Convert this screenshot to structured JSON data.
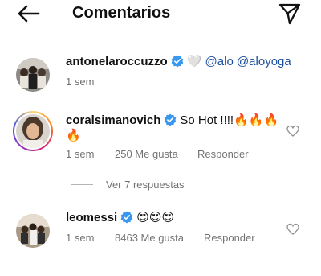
{
  "header": {
    "title": "Comentarios",
    "back_icon": "arrow-left-icon",
    "send_icon": "paper-plane-icon"
  },
  "comments": [
    {
      "username": "antonelaroccuzzo",
      "text": "@alo @aloyoga",
      "text_prefix": "🤍",
      "time": "1 sem"
    },
    {
      "username": "coralsimanovich",
      "text": "So Hot !!!!🔥🔥🔥",
      "text_cont": "🔥",
      "time": "1 sem",
      "likes": "250 Me gusta",
      "reply": "Responder"
    },
    {
      "username": "leomessi",
      "text": "😍😍😍",
      "time": "1 sem",
      "likes": "8463 Me gusta",
      "reply": "Responder"
    }
  ],
  "view_replies": "Ver 7 respuestas",
  "colors": {
    "verified": "#3897f0",
    "mention": "#1a4f9c",
    "secondary_text": "#737373"
  }
}
